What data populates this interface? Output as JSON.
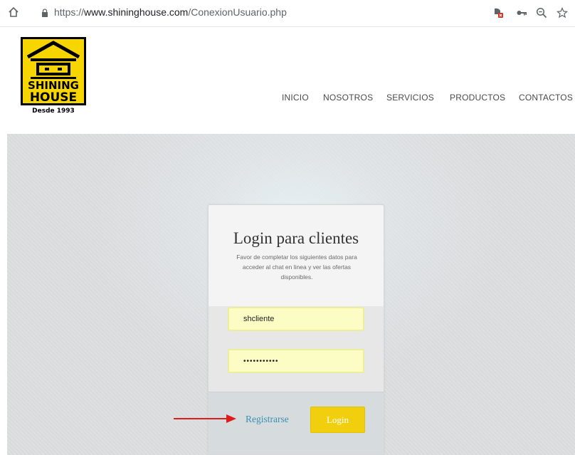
{
  "browser": {
    "url_prefix": "https://",
    "url_host": "www.shininghouse.com",
    "url_path": "/ConexionUsuario.php"
  },
  "logo": {
    "line1": "SHINING",
    "line2": "HOUSE",
    "tagline": "Desde 1993"
  },
  "nav": {
    "items": [
      "INICIO",
      "NOSOTROS",
      "SERVICIOS",
      "PRODUCTOS",
      "CONTACTOS"
    ]
  },
  "login": {
    "title": "Login para clientes",
    "description": "Favor de completar los siguientes datos para acceder al chat en linea y ver las ofertas disponibles.",
    "username_value": "shcliente",
    "password_value": "•••••••••••",
    "register_label": "Registrarse",
    "login_label": "Login"
  },
  "colors": {
    "accent_yellow": "#f2cf0e",
    "link_blue": "#3a8fb3",
    "arrow_red": "#e01b1b"
  }
}
